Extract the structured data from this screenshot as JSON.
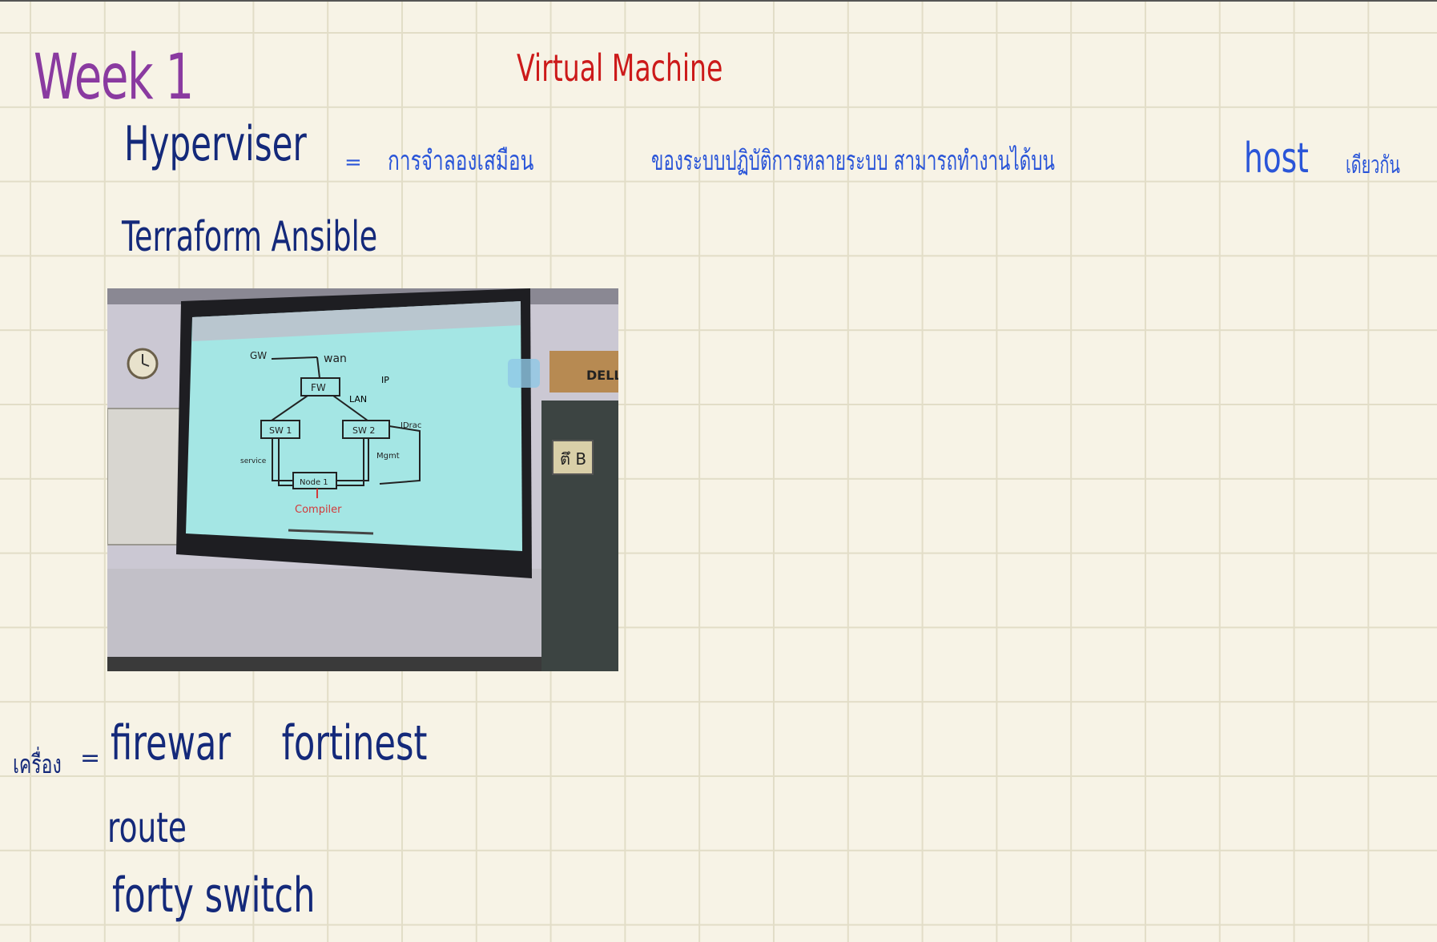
{
  "heading": {
    "week": "Week 1",
    "title": "Virtual Machine"
  },
  "line1": {
    "term": "Hyperviser",
    "equals": "=",
    "definition_part1": "การจำลองเสมือน",
    "definition_part2": "ของระบบปฏิบัติการหลายระบบ สามารถทำงานได้บน",
    "host": "host",
    "definition_part3": "เดียวกัน"
  },
  "line2": {
    "tools": "Terraform Ansible"
  },
  "photo": {
    "diagram": {
      "gw": "GW",
      "wan": "wan",
      "fw": "FW",
      "lan": "LAN",
      "ip": "IP",
      "sw1": "SW 1",
      "sw2": "SW 2",
      "idrac": "IDrac",
      "service": "service",
      "mgmt": "Mgmt",
      "node": "Node 1",
      "compute": "Compiler"
    },
    "sign": "ตึ B"
  },
  "devices": {
    "label": "เครื่อง",
    "equals": "=",
    "items": [
      "firewar",
      "fortinest",
      "route",
      "forty switch"
    ]
  },
  "colors": {
    "background": "#f7f3e6",
    "grid": "#e2ddc7",
    "week": "#8a3aa0",
    "title": "#cc1a1a",
    "ink_dark": "#14297a",
    "ink_blue": "#2a55d8"
  }
}
